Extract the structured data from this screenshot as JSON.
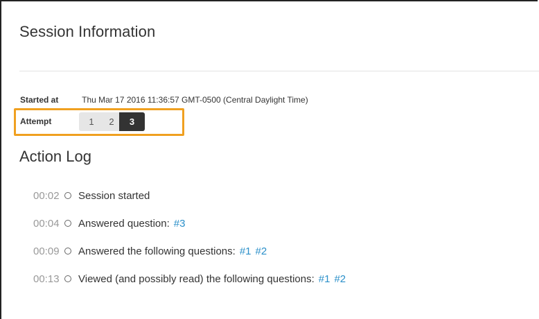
{
  "page": {
    "title": "Session Information"
  },
  "session": {
    "started_label": "Started at",
    "started_value": "Thu Mar 17 2016 11:36:57 GMT-0500 (Central Daylight Time)",
    "attempt_label": "Attempt",
    "attempts": [
      "1",
      "2",
      "3"
    ],
    "active_attempt": "3",
    "highlight_color": "#f0a020"
  },
  "action_log": {
    "title": "Action Log",
    "entries": [
      {
        "time": "00:02",
        "text": "Session started",
        "links": []
      },
      {
        "time": "00:04",
        "text": "Answered question:",
        "links": [
          "#3"
        ]
      },
      {
        "time": "00:09",
        "text": "Answered the following questions:",
        "links": [
          "#1",
          "#2"
        ]
      },
      {
        "time": "00:13",
        "text": "Viewed (and possibly read) the following questions:",
        "links": [
          "#1",
          "#2"
        ]
      }
    ]
  },
  "colors": {
    "link": "#2a8fc9",
    "active_button": "#333333",
    "timestamp": "#999999"
  }
}
